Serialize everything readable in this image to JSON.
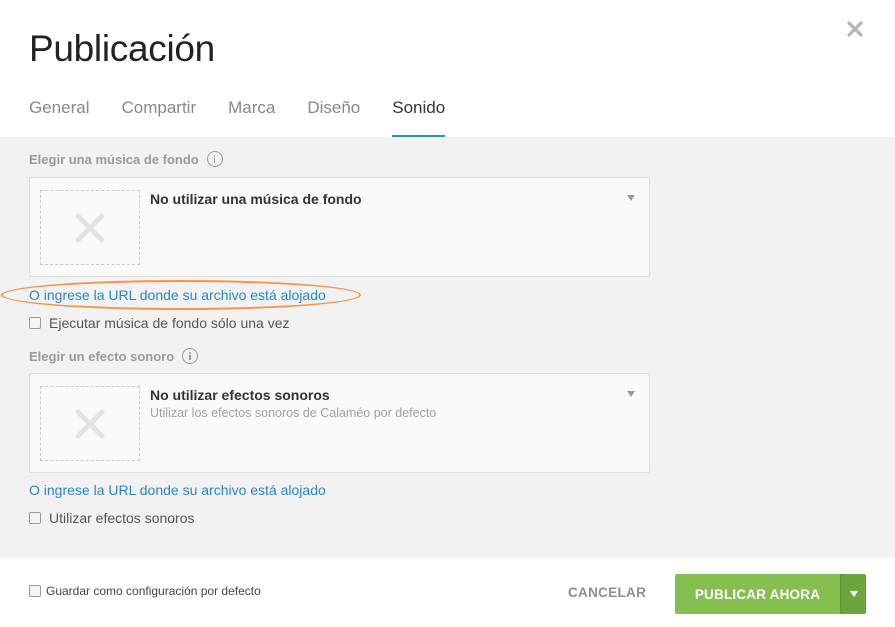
{
  "dialog": {
    "title": "Publicación"
  },
  "tabs": [
    {
      "label": "General"
    },
    {
      "label": "Compartir"
    },
    {
      "label": "Marca"
    },
    {
      "label": "Diseño"
    },
    {
      "label": "Sonido",
      "active": true
    }
  ],
  "music": {
    "section_label": "Elegir una música de fondo",
    "selected": "No utilizar una música de fondo",
    "url_link": "O ingrese la URL donde su archivo está alojado",
    "checkbox_label": "Ejecutar música de fondo sólo una vez",
    "checked": false
  },
  "effects": {
    "section_label": "Elegir un efecto sonoro",
    "selected": "No utilizar efectos sonoros",
    "selected_sub": "Utilizar los efectos sonoros de Calaméo por defecto",
    "url_link": "O ingrese la URL donde su archivo está alojado",
    "checkbox_label": "Utilizar efectos sonoros",
    "checked": false
  },
  "footer": {
    "default_checkbox_label": "Guardar como configuración por defecto",
    "cancel_label": "CANCELAR",
    "publish_label": "PUBLICAR AHORA"
  },
  "colors": {
    "accent": "#2d8fc4",
    "link": "#2a86c6",
    "publish": "#84bf4f",
    "highlight": "#f0964c"
  },
  "icons": {
    "close": "close-icon",
    "info": "info-icon",
    "placeholder": "x-placeholder-icon",
    "dropdown": "chevron-down-icon"
  }
}
